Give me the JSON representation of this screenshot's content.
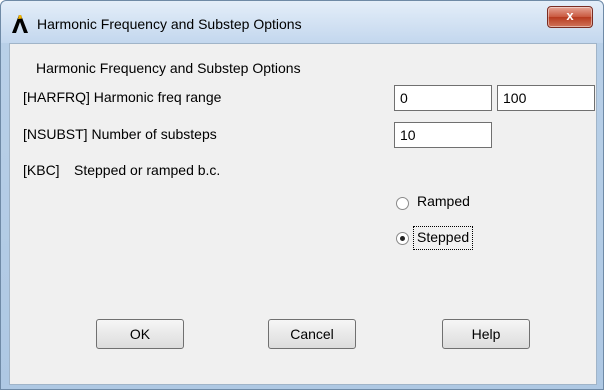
{
  "window": {
    "title": "Harmonic Frequency and Substep Options",
    "close_glyph": "x"
  },
  "form": {
    "heading": "Harmonic Frequency and Substep Options",
    "harfrq": {
      "label": "[HARFRQ]  Harmonic freq range",
      "start_value": "0",
      "end_value": "100"
    },
    "nsubst": {
      "label": "[NSUBST]  Number of substeps",
      "value": "10"
    },
    "kbc": {
      "tag": "[KBC]",
      "label": "Stepped or ramped b.c.",
      "options": [
        "Ramped",
        "Stepped"
      ],
      "selected": "Stepped"
    }
  },
  "buttons": {
    "ok": "OK",
    "cancel": "Cancel",
    "help": "Help"
  },
  "icons": {
    "app": "ansys-logo-icon",
    "close": "close-icon"
  }
}
